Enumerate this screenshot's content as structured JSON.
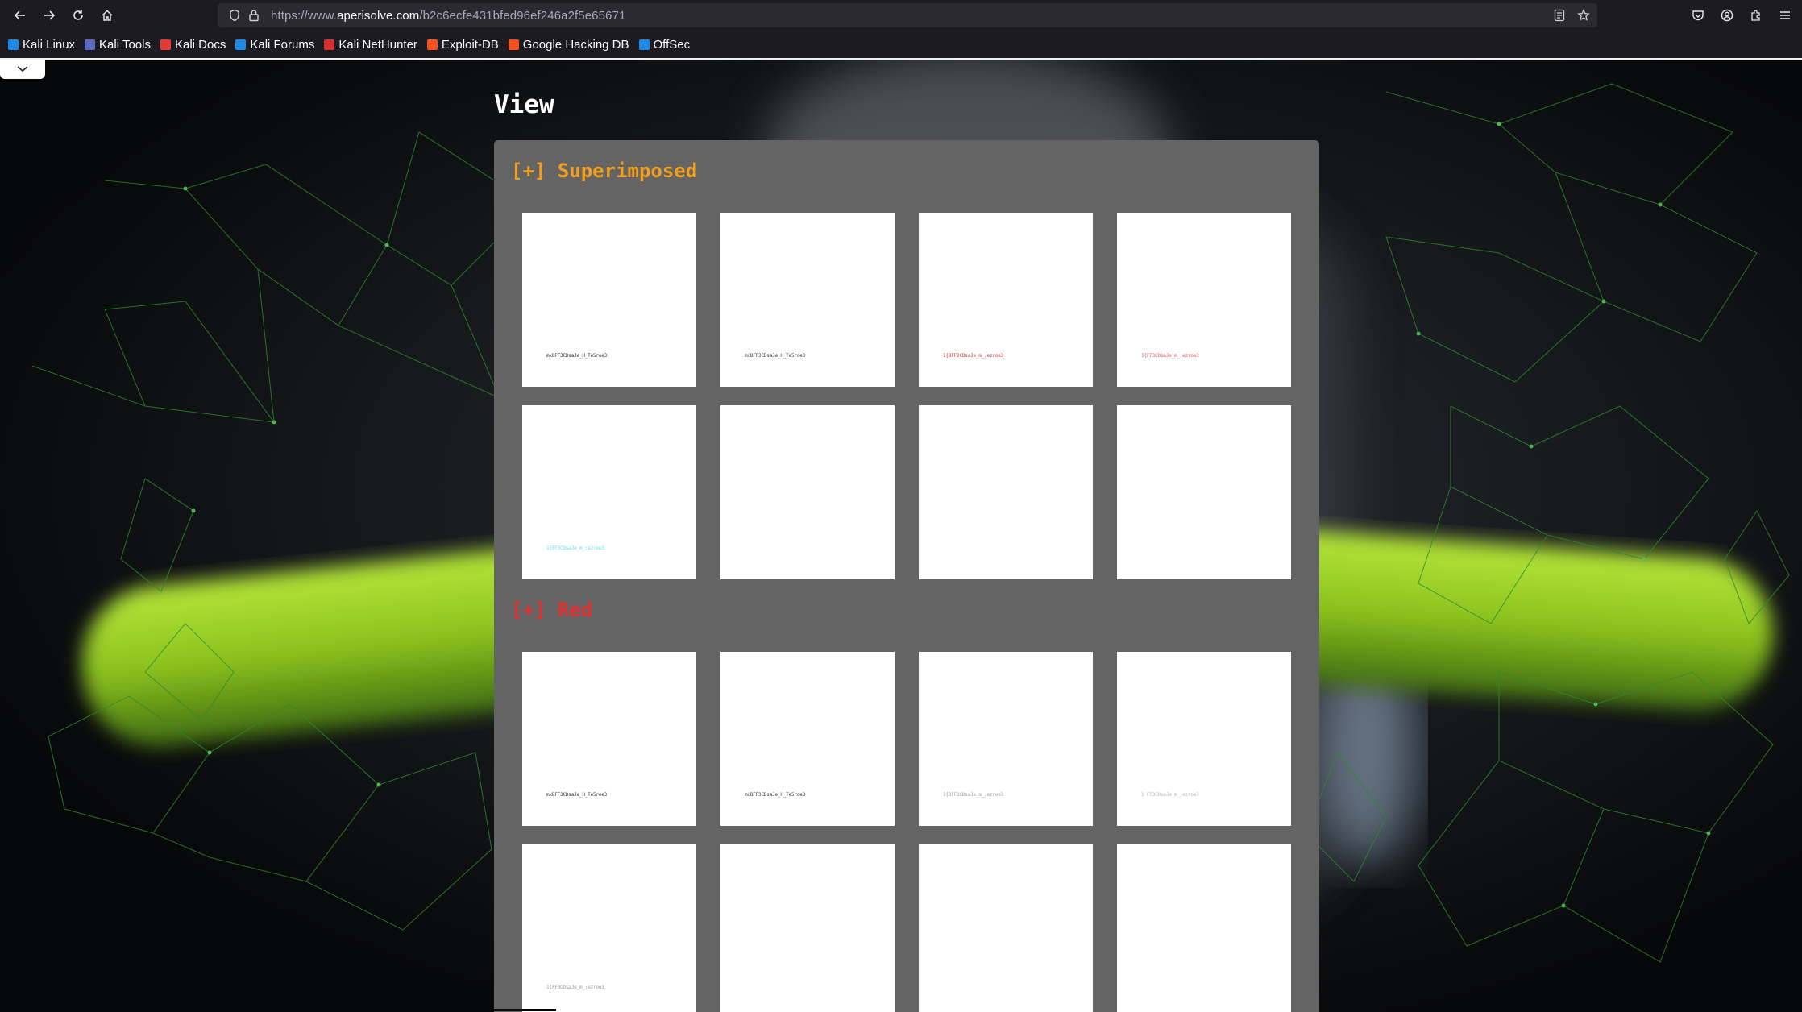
{
  "browser": {
    "url_prefix": "https://www.",
    "url_host": "aperisolve.com",
    "url_path": "/b2c6ecfe431bfed96ef246a2f5e65671",
    "bookmarks": [
      {
        "label": "Kali Linux",
        "icon": "kali-dragon-icon",
        "color": "#1e88e5"
      },
      {
        "label": "Kali Tools",
        "icon": "kali-tools-icon",
        "color": "#5c6bc0"
      },
      {
        "label": "Kali Docs",
        "icon": "kali-docs-icon",
        "color": "#e53935"
      },
      {
        "label": "Kali Forums",
        "icon": "kali-forums-icon",
        "color": "#1e88e5"
      },
      {
        "label": "Kali NetHunter",
        "icon": "nethunter-icon",
        "color": "#d32f2f"
      },
      {
        "label": "Exploit-DB",
        "icon": "exploit-db-icon",
        "color": "#f4511e"
      },
      {
        "label": "Google Hacking DB",
        "icon": "ghdb-icon",
        "color": "#f4511e"
      },
      {
        "label": "OffSec",
        "icon": "offsec-icon",
        "color": "#1e88e5"
      }
    ]
  },
  "page": {
    "title": "View",
    "sections": [
      {
        "title": "[+] Superimposed",
        "color": "#f0a020",
        "thumbs": [
          {
            "text": "mxBFF3CDsaJe_H_Te5roe3",
            "color": "#3a3030"
          },
          {
            "text": "mxBFF3CDsaJe_H_Te5roe3",
            "color": "#3a3a3a"
          },
          {
            "text": "1{BFF3CDsaJe_m_;ezroe3",
            "color": "#d04040"
          },
          {
            "text": "1{FF3CDsaJe_m_;ezroe3",
            "color": "#e06060"
          },
          {
            "text": "1{FF3CDsaJe_m_;ezroe3",
            "color": "#6ee0e8"
          },
          {
            "text": "",
            "color": "#000000"
          },
          {
            "text": "",
            "color": "#000000"
          },
          {
            "text": "",
            "color": "#000000"
          }
        ]
      },
      {
        "title": "[+] Red",
        "color": "#e03030",
        "thumbs": [
          {
            "text": "mxBFF3CDsaJe_H_Te5roe3",
            "color": "#3a3a3a"
          },
          {
            "text": "mxBFF3CDsaJe_H_Te5roe3",
            "color": "#3a3a3a"
          },
          {
            "text": "1{BFF3CDsaJe_m_;ezroe3",
            "color": "#a0a0a0"
          },
          {
            "text": "1 FF3CDsaJe_m_;ezroe3",
            "color": "#b8b8b8"
          },
          {
            "text": "1{FF3CDsaJe_m_;ezroe3",
            "color": "#9a9a9a"
          },
          {
            "text": "",
            "color": "#000000"
          },
          {
            "text": "",
            "color": "#000000"
          },
          {
            "text": "",
            "color": "#000000"
          }
        ]
      }
    ]
  }
}
